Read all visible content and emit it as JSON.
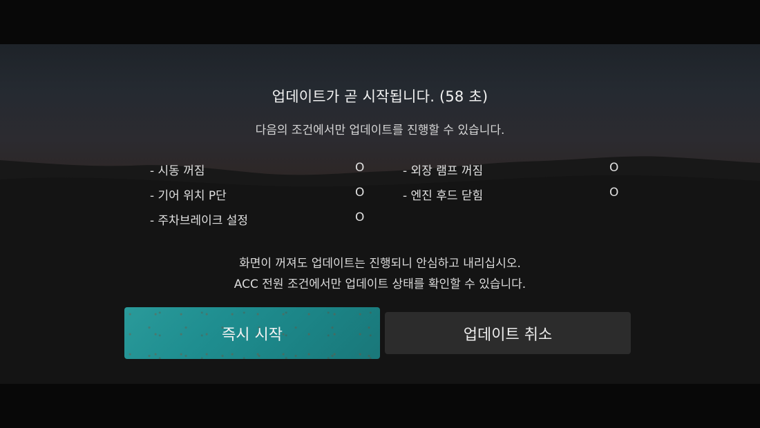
{
  "dialog": {
    "title": "업데이트가 곧 시작됩니다. (58 초)",
    "subtitle": "다음의 조건에서만 업데이트를 진행할 수 있습니다.",
    "conditions": [
      {
        "label": "- 시동 꺼짐",
        "status": "O"
      },
      {
        "label": "- 기어 위치 P단",
        "status": "O"
      },
      {
        "label": "- 주차브레이크 설정",
        "status": "O"
      },
      {
        "label": "- 외장 램프 꺼짐",
        "status": "O"
      },
      {
        "label": "- 엔진 후드 닫힘",
        "status": "O"
      }
    ],
    "note_line1": "화면이 꺼져도 업데이트는 진행되니 안심하고 내리십시오.",
    "note_line2": "ACC 전원 조건에서만 업데이트 상태를 확인할 수 있습니다.",
    "start_button": "즉시 시작",
    "cancel_button": "업데이트 취소"
  },
  "colors": {
    "start_button": "#1f8e90",
    "cancel_button": "#2c2c2c",
    "text": "#e9e9e9"
  }
}
